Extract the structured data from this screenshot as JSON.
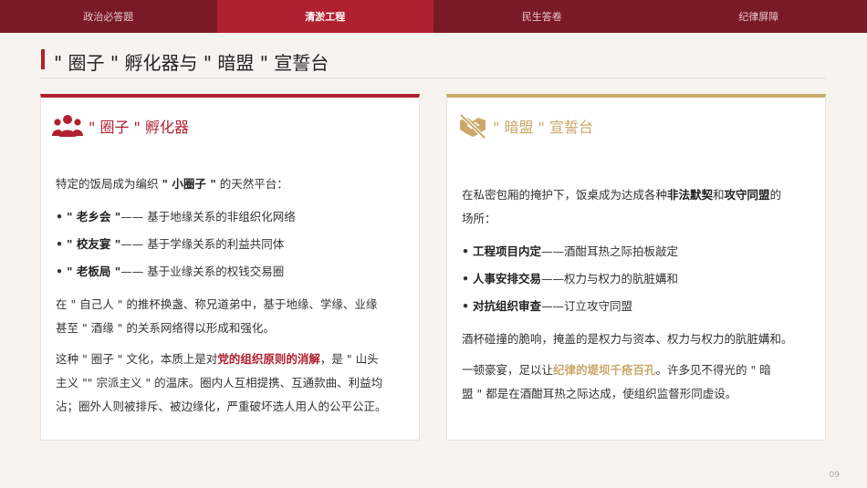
{
  "nav": {
    "tabs": [
      {
        "label": "政治必答题"
      },
      {
        "label": "清淤工程"
      },
      {
        "label": "民生答卷"
      },
      {
        "label": "纪律屏障"
      }
    ]
  },
  "page": {
    "title": "\" 圈子 \" 孵化器与 \" 暗盟 \" 宣誓台",
    "number": "09"
  },
  "left_card": {
    "title": "\" 圈子 \" 孵化器",
    "icon": "people-group-icon",
    "intro_a": "特定的饭局成为编织 ",
    "intro_bold": "\" 小圈子 \"",
    "intro_b": " 的天然平台：",
    "bullets": [
      {
        "term": "\" 老乡会 \"",
        "desc": "—— 基于地缘关系的非组织化网络"
      },
      {
        "term": "\" 校友宴 \"",
        "desc": "—— 基于学缘关系的利益共同体"
      },
      {
        "term": "\" 老板局 \"",
        "desc": "—— 基于业缘关系的权钱交易圈"
      }
    ],
    "para2_line1": "在 \" 自己人 \" 的推杯换盏、称兄道弟中，基于地缘、学缘、业缘",
    "para2_line2": "甚至 \" 酒缘 \" 的关系网络得以形成和强化。",
    "para3_a": "这种 \" 圈子 \" 文化，本质上是对",
    "para3_hl": "党的组织原则的消解",
    "para3_b": "，是 \" 山头",
    "para3_line2": "主义 \"\" 宗派主义 \" 的温床。圈内人互相提携、互通款曲、利益均",
    "para3_line3": "沾；圈外人则被排斥、被边缘化，严重破坏选人用人的公平公正。"
  },
  "right_card": {
    "title": "\" 暗盟 \" 宣誓台",
    "icon": "handshake-slash-icon",
    "intro_a": "在私密包厢的掩护下，饭桌成为达成各种",
    "intro_b1": "非法默契",
    "intro_and": "和",
    "intro_b2": "攻守同盟",
    "intro_c": "的",
    "intro_line2": "场所：",
    "bullets": [
      {
        "term": "工程项目内定",
        "desc": "——酒酣耳热之际拍板敲定"
      },
      {
        "term": "人事安排交易",
        "desc": "——权力与权力的肮脏媾和"
      },
      {
        "term": "对抗组织审查",
        "desc": "——订立攻守同盟"
      }
    ],
    "para2": "酒杯碰撞的脆响，掩盖的是权力与资本、权力与权力的肮脏媾和。",
    "para3_a": "一顿豪宴，足以让",
    "para3_hl": "纪律的堤坝千疮百孔",
    "para3_b": "。许多见不得光的 \" 暗",
    "para3_line2": "盟 \" 都是在酒酣耳热之际达成，使组织监督形同虚设。"
  },
  "colors": {
    "nav_bg": "#7a1a26",
    "nav_active": "#b0202f",
    "accent_red": "#b0202f",
    "accent_gold": "#c9a86a",
    "page_bg": "#f7f3ee"
  }
}
